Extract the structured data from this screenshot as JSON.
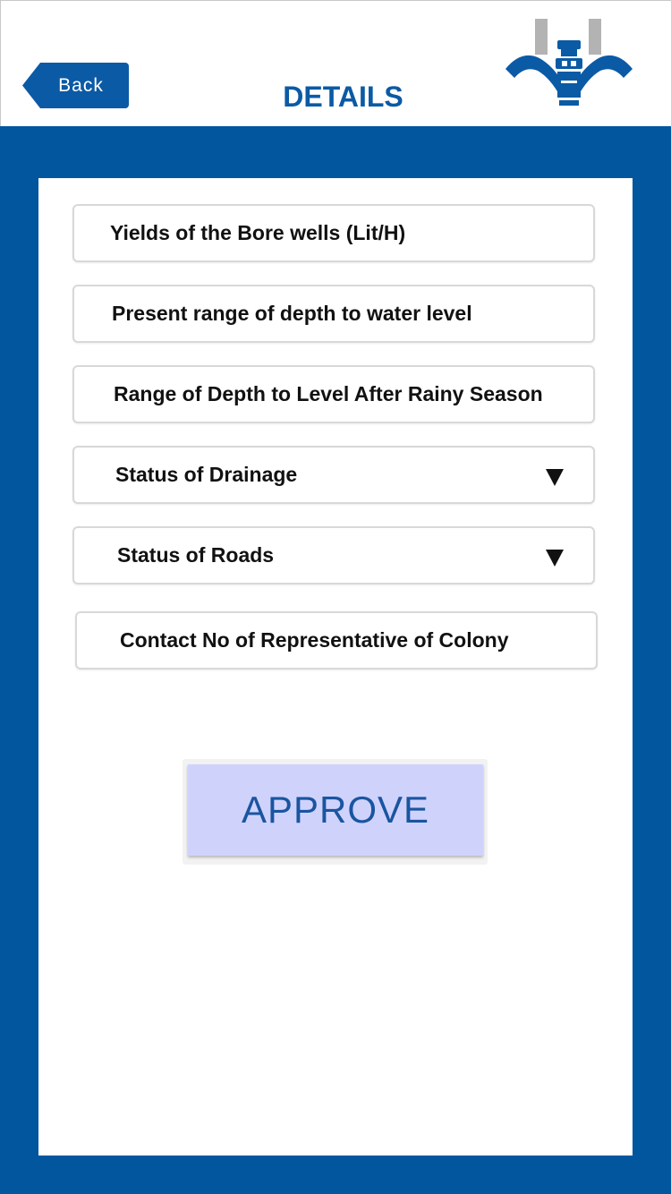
{
  "header": {
    "back_label": "Back",
    "title": "DETAILS",
    "logo_icon": "water-tap-logo-icon"
  },
  "colors": {
    "brand_blue": "#02569e",
    "title_blue": "#0b5aa5",
    "approve_bg": "#cfd3fc",
    "logo_grey": "#b3b3b3"
  },
  "form": {
    "fields": [
      {
        "label": "Yields of the Bore wells (Lit/H)",
        "type": "text"
      },
      {
        "label": "Present range of depth to water level",
        "type": "text"
      },
      {
        "label": "Range of Depth to Level After Rainy Season",
        "type": "text"
      },
      {
        "label": "Status of Drainage",
        "type": "dropdown",
        "icon": "caret-down-icon"
      },
      {
        "label": "Status of Roads",
        "type": "dropdown",
        "icon": "caret-down-icon"
      },
      {
        "label": "Contact No of Representative of Colony",
        "type": "text"
      }
    ],
    "approve_label": "APPROVE"
  }
}
